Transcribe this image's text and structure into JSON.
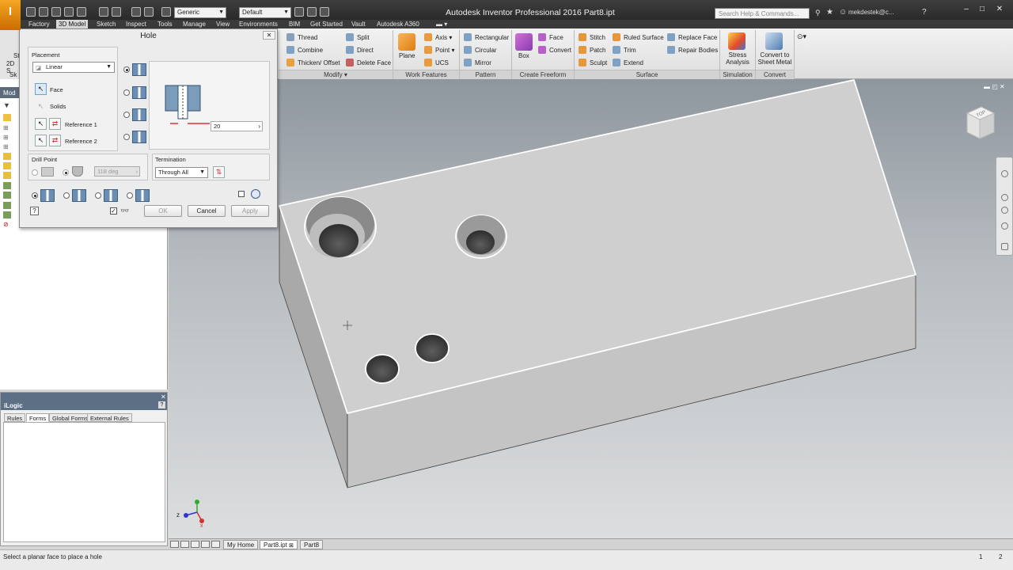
{
  "app": {
    "window_title": "Autodesk Inventor Professional 2016    Part8.ipt",
    "logo_text": "I",
    "search_placeholder": "Search Help & Commands...",
    "user": "mekdestek@c...",
    "quick_access": {
      "material": "Generic",
      "appearance": "Default"
    }
  },
  "ribbon_tabs": [
    "Factory",
    "3D Model",
    "Sketch",
    "Inspect",
    "Tools",
    "Manage",
    "View",
    "Environments",
    "BIM",
    "Get Started",
    "Vault",
    "Autodesk A360"
  ],
  "ribbon": {
    "modify": {
      "label": "Modify",
      "items": [
        "Thread",
        "Combine",
        "Thicken/ Offset",
        "Split",
        "Direct",
        "Delete Face"
      ]
    },
    "work_features": {
      "label": "Work Features",
      "plane": "Plane",
      "items": [
        "Axis",
        "Point",
        "UCS"
      ]
    },
    "pattern": {
      "label": "Pattern",
      "items": [
        "Rectangular",
        "Circular",
        "Mirror"
      ]
    },
    "create_freeform": {
      "label": "Create Freeform",
      "box": "Box",
      "items": [
        "Face",
        "Convert"
      ]
    },
    "surface": {
      "label": "Surface",
      "items": [
        "Stitch",
        "Patch",
        "Sculpt",
        "Ruled Surface",
        "Trim",
        "Extend",
        "Replace Face",
        "Repair Bodies"
      ]
    },
    "simulation": {
      "label": "Simulation",
      "stress": "Stress Analysis"
    },
    "convert": {
      "label": "Convert",
      "sheet_metal": "Convert to Sheet Metal"
    }
  },
  "browser": {
    "header": "Mod",
    "left_labels": [
      "St",
      "2D S",
      "Sk"
    ]
  },
  "ilogic": {
    "title": "iLogic",
    "tabs": [
      "Rules",
      "Forms",
      "Global Forms",
      "External Rules"
    ],
    "active_tab": "Forms"
  },
  "hole_dialog": {
    "title": "Hole",
    "placement_label": "Placement",
    "placement_value": "Linear",
    "face_label": "Face",
    "solids_label": "Solids",
    "ref1_label": "Reference 1",
    "ref2_label": "Reference 2",
    "diameter_value": "20",
    "drill_point_label": "Drill Point",
    "drill_angle": "118 deg",
    "termination_label": "Termination",
    "termination_value": "Through All",
    "ok": "OK",
    "cancel": "Cancel",
    "apply": "Apply"
  },
  "doc_tabs": [
    "My Home",
    "Part8.ipt",
    "Part8"
  ],
  "active_doc_tab": "Part8.ipt",
  "status": {
    "message": "Select a planar face to place a hole",
    "count1": "1",
    "count2": "2"
  },
  "viewcube_label": "TOP",
  "colors": {
    "accent_orange": "#f39c12",
    "hole_blue": "#6b8fb4",
    "title_bar": "#2f2f2f"
  }
}
